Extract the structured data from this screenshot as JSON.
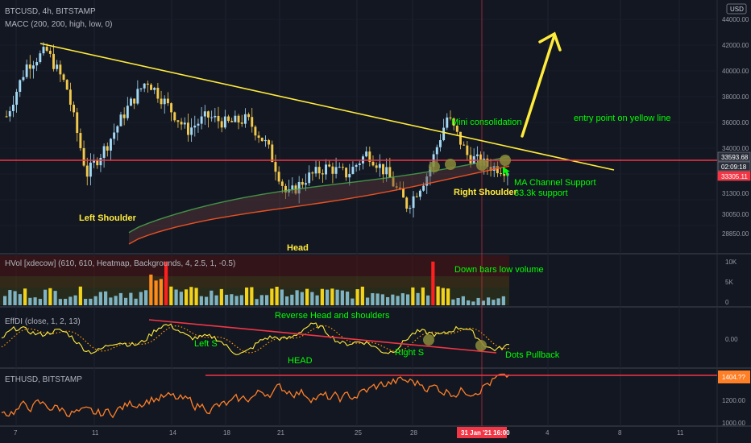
{
  "header": {
    "symbol": "BTCUSD, 4h, BITSTAMP",
    "ma_indicator": "MACC (200, 200, high, low, 0)",
    "currency": "USD"
  },
  "price_axis": {
    "ticks": [
      "44000.00",
      "42000.00",
      "40000.00",
      "38000.00",
      "36000.00",
      "34000.00",
      "31300.00",
      "30050.00",
      "28850.00"
    ],
    "tags": [
      {
        "text": "33593.68",
        "color": "#2a2e39",
        "border": "#6b6f7a"
      },
      {
        "text": "02:09:18",
        "color": "#2a2e39",
        "border": "#6b6f7a"
      },
      {
        "text": "33305.11",
        "color": "#f23645",
        "border": "#f23645"
      }
    ]
  },
  "hvol": {
    "header": "HVol [xdecow] (610, 610, Heatmap, Backgrounds, 4, 2.5, 1, -0.5)",
    "ticks": [
      "10K",
      "5K",
      "0"
    ]
  },
  "ehlers": {
    "header": "EffDI (close, 1, 2, 13)",
    "ticks": [
      "0.00"
    ]
  },
  "eth": {
    "header": "ETHUSD, BITSTAMP",
    "ticks": [
      "1200.00",
      "1000.00"
    ],
    "tag": "1404.??"
  },
  "time_axis": {
    "ticks": [
      "7",
      "11",
      "14",
      "18",
      "21",
      "25",
      "28",
      "4",
      "8",
      "11"
    ],
    "current": "31 Jan '21   16:00"
  },
  "annotations": {
    "left_shoulder": "Left Shoulder",
    "head": "Head",
    "right_shoulder": "Right Shoulder",
    "mini_consolidation": "Mini consolidation",
    "entry_point": "entry point on yellow line",
    "ma_channel": "MA Channel Support",
    "support": "33.3k support",
    "down_bars": "Down bars low volume",
    "reverse_hs": "Reverse Head and shoulders",
    "left_s": "Left S",
    "head_upper": "HEAD",
    "right_s": "Right S",
    "dots_pullback": "Dots Pullback"
  },
  "colors": {
    "background": "#131722",
    "trendline": "#ffeb3b",
    "support_line": "#f23645",
    "ma_fast": "#4caf50",
    "ma_slow": "#ff5722",
    "eth_line": "#ff7f27",
    "annotation_green": "#00ff00",
    "annotation_yellow": "#ffeb3b",
    "candle_up": "#a3d9f5",
    "candle_down": "#f2c94c"
  },
  "chart_data": [
    {
      "type": "candlestick",
      "title": "BTCUSD, 4h, BITSTAMP",
      "ylim": [
        27600,
        45000
      ],
      "price_series": {
        "x": [
          "Jan 7",
          "Jan 8",
          "Jan 9",
          "Jan 10",
          "Jan 11",
          "Jan 12",
          "Jan 13",
          "Jan 14",
          "Jan 15",
          "Jan 16",
          "Jan 17",
          "Jan 18",
          "Jan 19",
          "Jan 20",
          "Jan 21",
          "Jan 22",
          "Jan 23",
          "Jan 24",
          "Jan 25",
          "Jan 26",
          "Jan 27",
          "Jan 28",
          "Jan 29",
          "Jan 30",
          "Jan 31",
          "Feb 1"
        ],
        "close": [
          37000,
          40500,
          41500,
          39000,
          33000,
          35000,
          37500,
          39500,
          37800,
          36000,
          37000,
          36500,
          36800,
          35000,
          31500,
          32800,
          33500,
          33000,
          34500,
          33000,
          30800,
          33000,
          37000,
          34300,
          33600,
          33300
        ]
      },
      "moving_averages": [
        {
          "name": "MA 200 high",
          "values_start": 29000,
          "values_end": 34300
        },
        {
          "name": "MA 200 low",
          "values_start": 28000,
          "values_end": 33400
        }
      ],
      "trendline": {
        "from": [
          "Jan 7",
          42100
        ],
        "to": [
          "Feb 8",
          33000
        ]
      },
      "support_level": 33305.11,
      "current_price": 33593.68
    },
    {
      "type": "bar",
      "title": "HVol [xdecow]",
      "ylim": [
        0,
        12000
      ],
      "note": "volume bars with heatmap coloring; spikes on Jan 11 and Jan 29"
    },
    {
      "type": "line",
      "title": "EffDI (close, 1, 2, 13)",
      "zero_line": 0.0
    },
    {
      "type": "line",
      "title": "ETHUSD, BITSTAMP",
      "ylim": [
        950,
        1450
      ],
      "resistance": 1404
    }
  ]
}
